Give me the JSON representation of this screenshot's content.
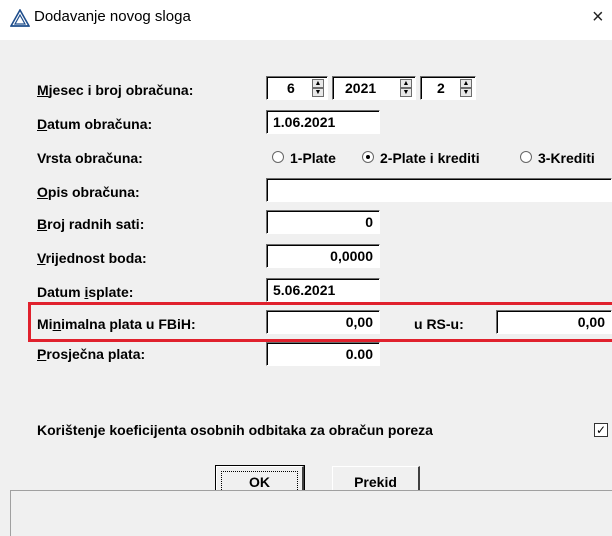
{
  "window": {
    "title": "Dodavanje novog sloga",
    "close_glyph": "×",
    "icon": "app-triangle-icon"
  },
  "form": {
    "mjesec_label": "Mjesec i broj obračuna:",
    "mjesec_value": "6",
    "godina_value": "2021",
    "broj_value": "2",
    "datum_obracuna_label": "Datum obračuna:",
    "datum_obracuna_value": "1.06.2021",
    "vrsta_label": "Vrsta obračuna:",
    "vrsta_options": [
      "1-Plate",
      "2-Plate i krediti",
      "3-Krediti"
    ],
    "vrsta_selected": "2-Plate i krediti",
    "opis_label": "Opis obračuna:",
    "opis_value": "",
    "sati_label": "Broj radnih sati:",
    "sati_value": "0",
    "bod_label": "Vrijednost boda:",
    "bod_value": "0,0000",
    "isplata_label": "Datum isplate:",
    "isplata_value": "5.06.2021",
    "min_plata_label": "Minimalna plata u FBiH:",
    "min_plata_value": "0,00",
    "rs_label": "u RS-u:",
    "rs_value": "0,00",
    "prosjecna_label": "Prosječna plata:",
    "prosjecna_value": "0.00",
    "koef_label": "Korištenje koeficijenta osobnih odbitaka za obračun poreza",
    "koef_checked": true
  },
  "buttons": {
    "ok": "OK",
    "cancel": "Prekid"
  },
  "colors": {
    "highlight": "#e0212d"
  }
}
